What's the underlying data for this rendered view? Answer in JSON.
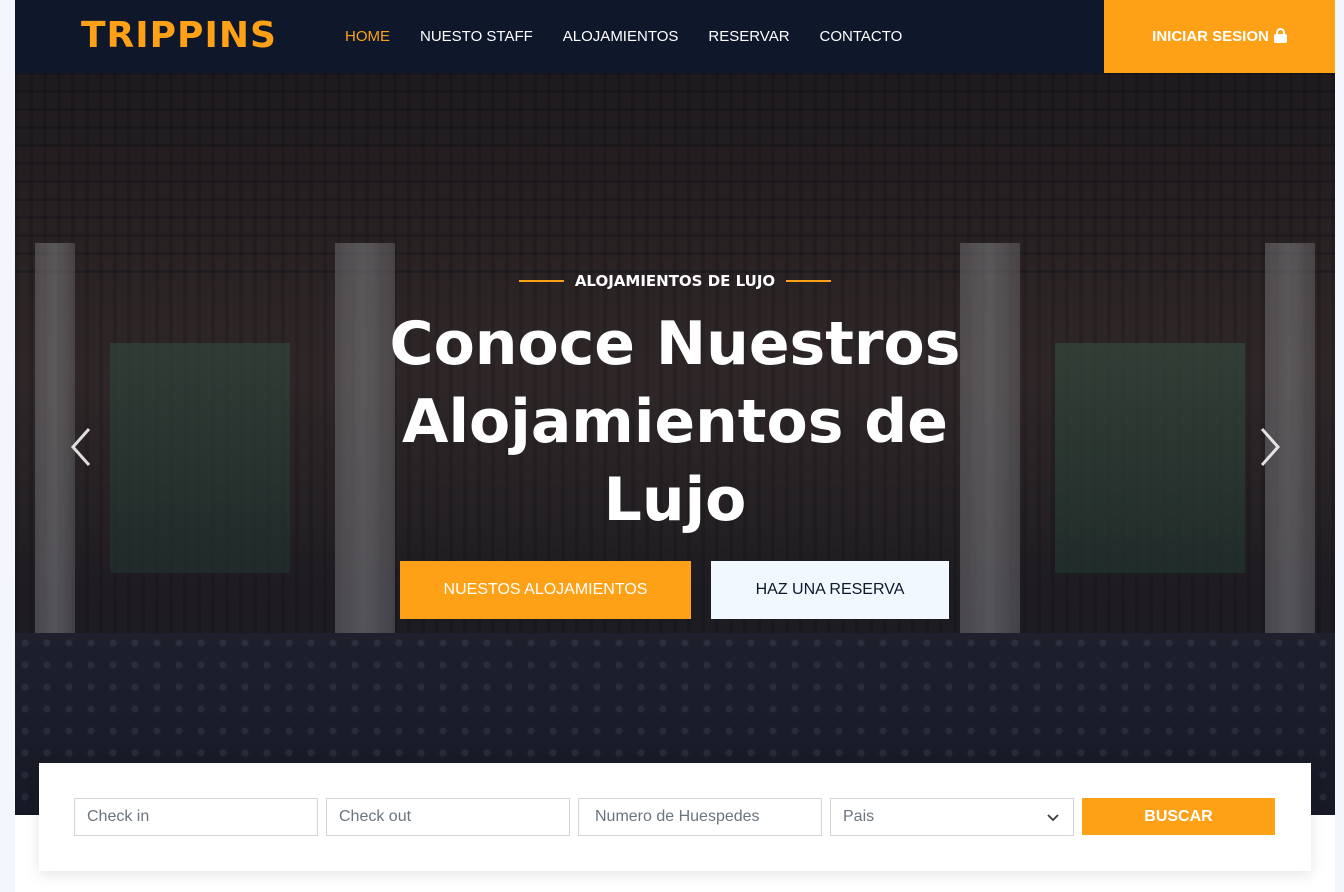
{
  "brand": {
    "name": "TRIPPINS",
    "color": "#fea116"
  },
  "nav": {
    "items": [
      {
        "label": "HOME",
        "active": true
      },
      {
        "label": "NUESTO STAFF",
        "active": false
      },
      {
        "label": "ALOJAMIENTOS",
        "active": false
      },
      {
        "label": "RESERVAR",
        "active": false
      },
      {
        "label": "CONTACTO",
        "active": false
      }
    ],
    "login_label": "INICIAR SESION",
    "login_icon": "lock-icon"
  },
  "hero": {
    "subtitle": "ALOJAMIENTOS DE LUJO",
    "title": "Conoce Nuestros Alojamientos de Lujo",
    "primary_button": "NUESTOS ALOJAMIENTOS",
    "secondary_button": "HAZ UNA RESERVA",
    "prev_icon": "chevron-left-icon",
    "next_icon": "chevron-right-icon"
  },
  "booking": {
    "checkin_placeholder": "Check in",
    "checkout_placeholder": "Check out",
    "guests_placeholder": "Numero de Huespedes",
    "country_value": "Pais",
    "search_label": "BUSCAR"
  },
  "colors": {
    "accent": "#fea116",
    "dark": "#0f172b",
    "light": "#f1f8ff"
  }
}
